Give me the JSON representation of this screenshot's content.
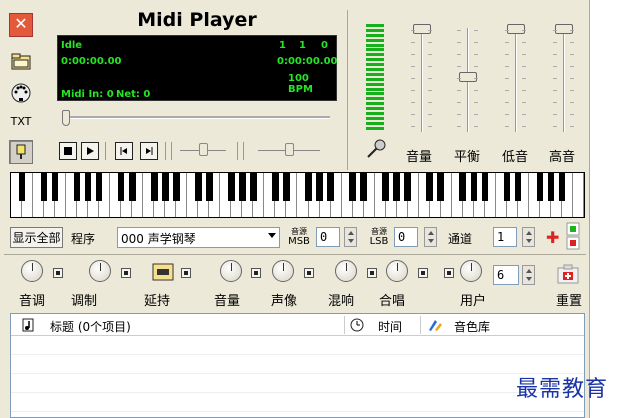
{
  "window": {
    "title": "Midi Player"
  },
  "lcd": {
    "status": "Idle",
    "position_a": "1",
    "position_b": "1",
    "position_c": "0",
    "time_elapsed": "0:00:00.00",
    "time_total": "0:00:00.00",
    "tempo": "100 BPM",
    "midi_in": "Midi In: 0",
    "net": "Net: 0"
  },
  "left_tools": {
    "txt_label": "TXT"
  },
  "playback": {
    "progress": 0
  },
  "mixer": {
    "labels": [
      "音量",
      "平衡",
      "低音",
      "高音"
    ]
  },
  "program_row": {
    "show_all_label": "显示全部",
    "program_label": "程序",
    "program_value": "000 声学钢琴",
    "msb_top": "音源",
    "msb_bottom": "MSB",
    "msb_value": "0",
    "lsb_top": "音源",
    "lsb_bottom": "LSB",
    "lsb_value": "0",
    "channel_label": "通道",
    "channel_value": "1"
  },
  "controls": {
    "labels": [
      "音调",
      "调制",
      "延持",
      "音量",
      "声像",
      "混响",
      "合唱",
      "用户",
      "重置"
    ],
    "user_value": "6"
  },
  "list": {
    "title_col": "标题 (0个项目)",
    "time_col": "时间",
    "bank_col": "音色库"
  },
  "watermark": "最需教育",
  "colors": {
    "lcd_text": "#25e525",
    "meter": "#16b01b",
    "close": "#e35a3a",
    "watermark": "#1a33a5"
  }
}
